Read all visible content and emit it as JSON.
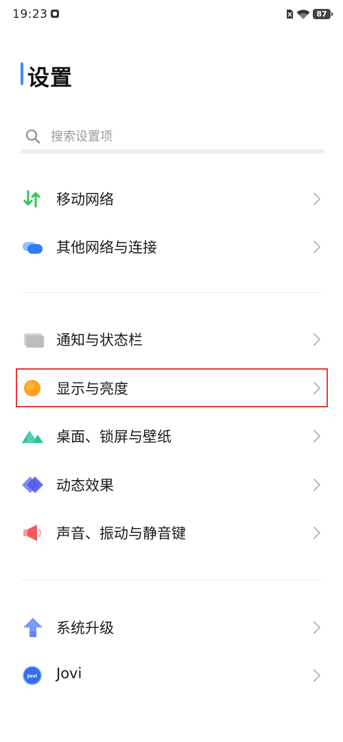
{
  "status_bar": {
    "time": "19:23",
    "battery": "87"
  },
  "page": {
    "title": "设置"
  },
  "search": {
    "placeholder": "搜索设置项",
    "value": ""
  },
  "groups": [
    {
      "items": [
        {
          "label": "移动网络",
          "icon": "mobile-data-icon"
        },
        {
          "label": "其他网络与连接",
          "icon": "cloud-connection-icon"
        }
      ]
    },
    {
      "items": [
        {
          "label": "通知与状态栏",
          "icon": "notification-icon"
        },
        {
          "label": "显示与亮度",
          "icon": "display-brightness-icon"
        },
        {
          "label": "桌面、锁屏与壁纸",
          "icon": "wallpaper-icon"
        },
        {
          "label": "动态效果",
          "icon": "animation-icon"
        },
        {
          "label": "声音、振动与静音键",
          "icon": "speaker-icon"
        }
      ]
    },
    {
      "items": [
        {
          "label": "系统升级",
          "icon": "system-update-icon"
        },
        {
          "label": "Jovi",
          "icon": "jovi-icon"
        }
      ]
    }
  ],
  "colors": {
    "accent": "#3b8cf7",
    "highlight": "#e53935",
    "mobile_data": "#34c759",
    "display": "#ffa31a",
    "wallpaper": "#2dbf9b",
    "animation": "#5b6cf0",
    "speaker": "#f25b5b",
    "update": "#5f86f5"
  },
  "highlighted_item": "显示与亮度"
}
